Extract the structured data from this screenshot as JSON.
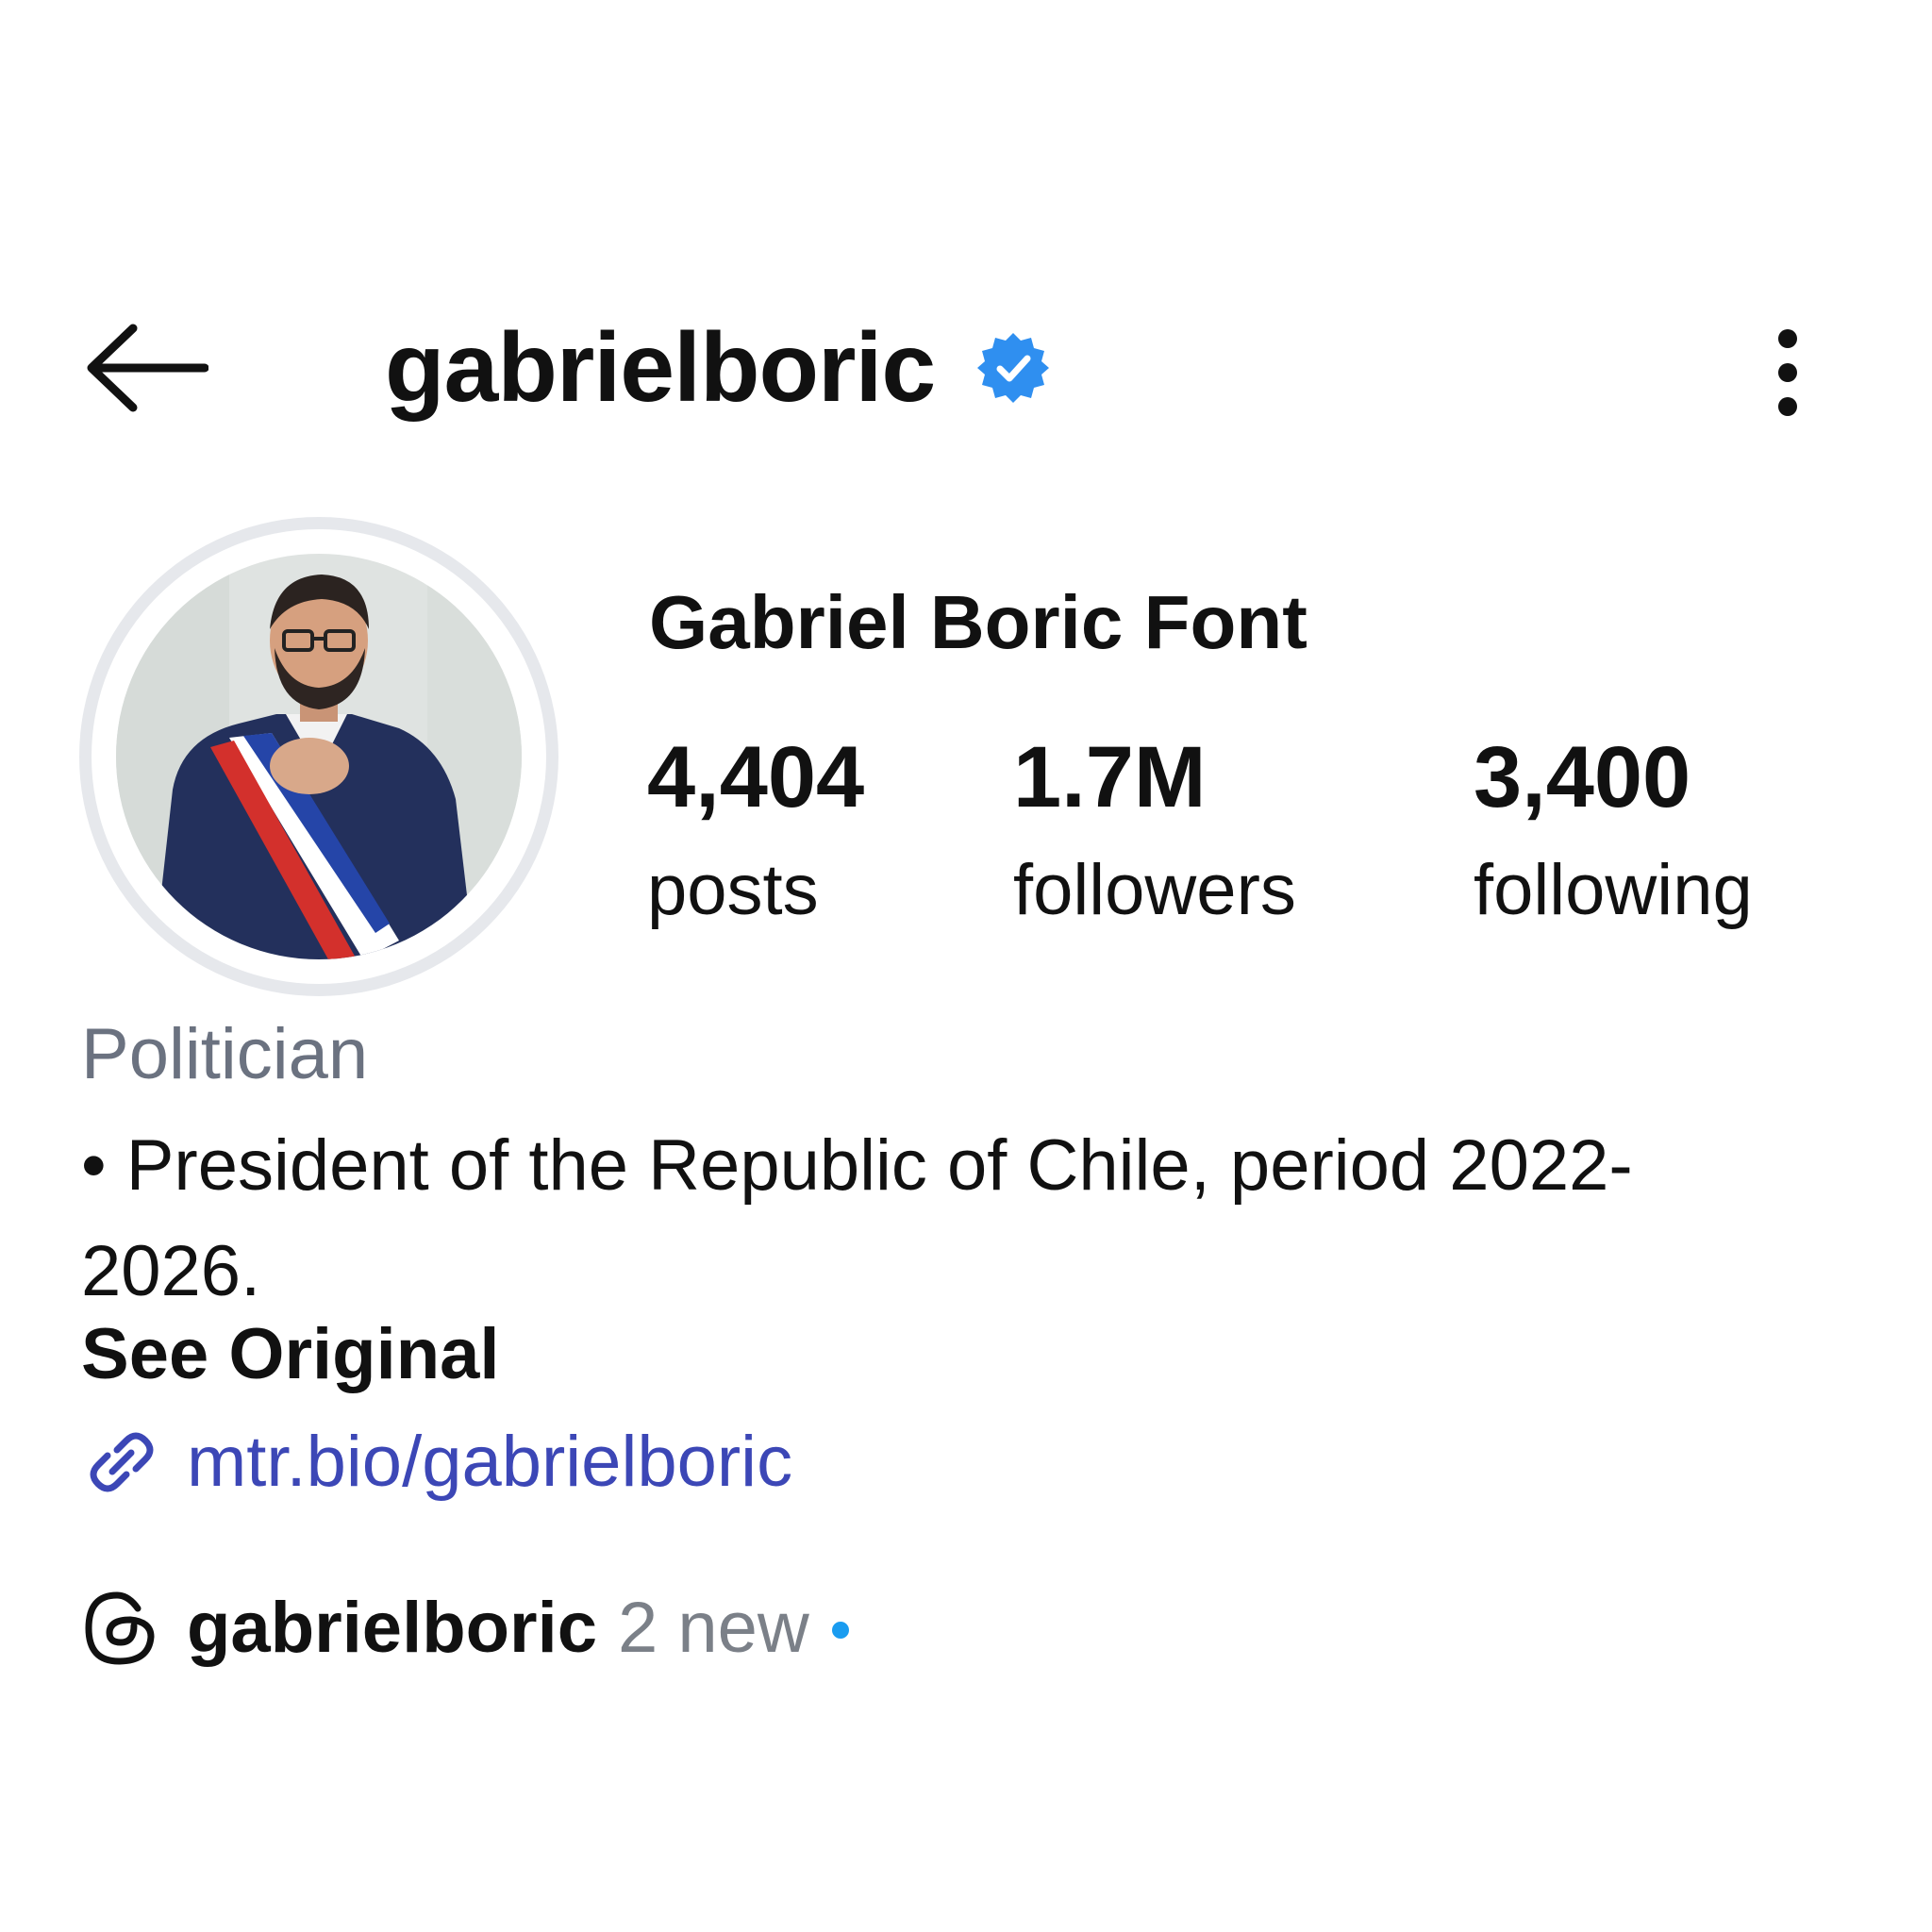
{
  "header": {
    "username": "gabrielboric",
    "back_icon": "arrow-left-icon",
    "verified_icon": "verified-badge-icon",
    "more_icon": "more-vertical-icon"
  },
  "profile": {
    "full_name": "Gabriel Boric Font",
    "stats": {
      "posts": {
        "value": "4,404",
        "label": "posts"
      },
      "followers": {
        "value": "1.7M",
        "label": "followers"
      },
      "following": {
        "value": "3,400",
        "label": "following"
      }
    },
    "category": "Politician",
    "bio": "• President of the Republic of Chile, period 2022-2026.",
    "see_original": "See Original",
    "link": {
      "icon": "link-icon",
      "text": "mtr.bio/gabrielboric"
    },
    "threads": {
      "icon": "threads-icon",
      "username": "gabrielboric",
      "new_text": "2 new"
    }
  },
  "colors": {
    "verified": "#2f8ff0",
    "link": "#3c47b6",
    "muted": "#6b7280",
    "new_dot": "#1a9cf0",
    "avatar_ring": "#e6e8ec"
  }
}
